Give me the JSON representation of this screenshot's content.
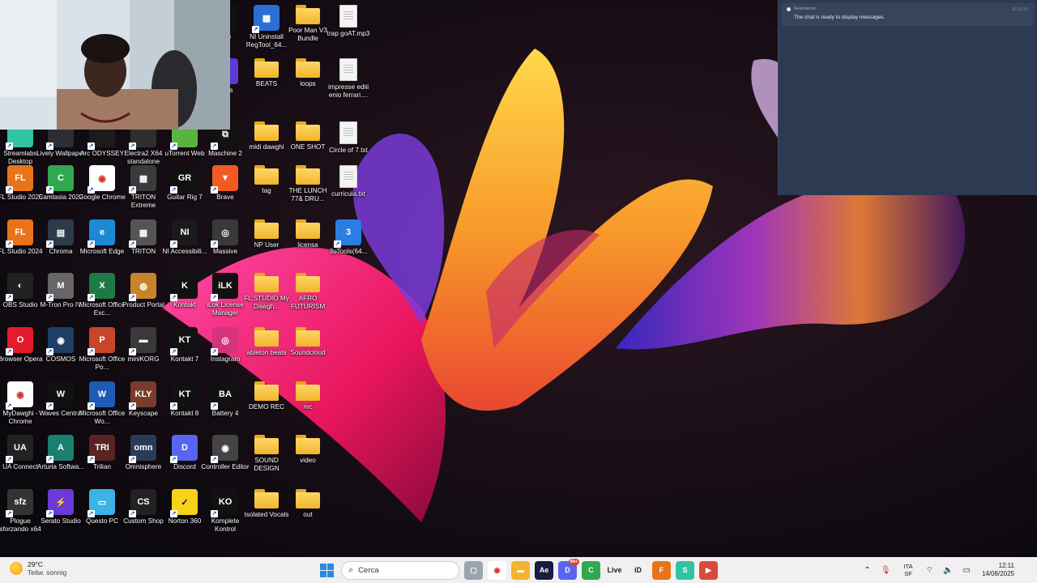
{
  "desktop": {
    "icons": [
      {
        "label": "Streamlabs Desktop",
        "kind": "app",
        "color": "#31c3a2",
        "text": ""
      },
      {
        "label": "Lively Wallpaper",
        "kind": "app",
        "color": "#2d2d35",
        "text": ""
      },
      {
        "label": "Arc ODYSSEY",
        "kind": "app",
        "color": "#1b1b1b",
        "text": ""
      },
      {
        "label": "Electra2 X64 standalone",
        "kind": "app",
        "color": "#2e2e2e",
        "text": ""
      },
      {
        "label": "uTorrent Web",
        "kind": "app",
        "color": "#58b441",
        "text": ""
      },
      {
        "label": "Maschine 2",
        "kind": "app",
        "color": "#111",
        "text": "⧉"
      },
      {
        "label": "midi dawghi",
        "kind": "folder"
      },
      {
        "label": "ONE SHOT",
        "kind": "folder"
      },
      {
        "label": "Circle of 7.txt",
        "kind": "file"
      },
      {
        "label": "FL Studio 2025",
        "kind": "app",
        "color": "#e9731b",
        "text": "FL"
      },
      {
        "label": "Camtasia 2022",
        "kind": "app",
        "color": "#2fa84e",
        "text": "C"
      },
      {
        "label": "Google Chrome",
        "kind": "app",
        "color": "#ffffff",
        "text": "◉"
      },
      {
        "label": "TRITON Extreme",
        "kind": "app",
        "color": "#3b3b3b",
        "text": "▦"
      },
      {
        "label": "Guitar Rig 7",
        "kind": "app",
        "color": "#111",
        "text": "GR"
      },
      {
        "label": "Brave",
        "kind": "app",
        "color": "#f15a22",
        "text": "▼"
      },
      {
        "label": "tag",
        "kind": "folder"
      },
      {
        "label": "THE LUNCH 77& DRU...",
        "kind": "folder"
      },
      {
        "label": "curricula.txt",
        "kind": "file"
      },
      {
        "label": "FL Studio 2024",
        "kind": "app",
        "color": "#e9731b",
        "text": "FL"
      },
      {
        "label": "Chroma",
        "kind": "app",
        "color": "#2d3a4a",
        "text": "▤"
      },
      {
        "label": "Microsoft Edge",
        "kind": "app",
        "color": "#1b8ad6",
        "text": "e"
      },
      {
        "label": "TRITON",
        "kind": "app",
        "color": "#555",
        "text": "▦"
      },
      {
        "label": "NI Accessibili...",
        "kind": "app",
        "color": "#1a1a1a",
        "text": "NI"
      },
      {
        "label": "Massive",
        "kind": "app",
        "color": "#3a3a3a",
        "text": "◎"
      },
      {
        "label": "NP User",
        "kind": "folder"
      },
      {
        "label": "licensa",
        "kind": "folder"
      },
      {
        "label": "3uTools(64...",
        "kind": "app",
        "color": "#2a7de1",
        "text": "3"
      },
      {
        "label": "OBS Studio",
        "kind": "app",
        "color": "#222",
        "text": "◐"
      },
      {
        "label": "M-Tron Pro IV",
        "kind": "app",
        "color": "#666",
        "text": "M"
      },
      {
        "label": "Microsoft Office Exc...",
        "kind": "app",
        "color": "#1d7a44",
        "text": "X"
      },
      {
        "label": "Product Portal",
        "kind": "app",
        "color": "#c7852b",
        "text": "◍"
      },
      {
        "label": "Kontakt",
        "kind": "app",
        "color": "#111",
        "text": "K"
      },
      {
        "label": "iLok License Manager",
        "kind": "app",
        "color": "#111",
        "text": "iLK"
      },
      {
        "label": "FL STUDIO My Dawgh...",
        "kind": "folder"
      },
      {
        "label": "AFRO FUTURISM",
        "kind": "folder"
      },
      {
        "label": "Browser Opera",
        "kind": "app",
        "color": "#e21c2c",
        "text": "O"
      },
      {
        "label": "COSMOS",
        "kind": "app",
        "color": "#1d3f66",
        "text": "◉"
      },
      {
        "label": "Microsoft Office Po...",
        "kind": "app",
        "color": "#c8452a",
        "text": "P"
      },
      {
        "label": "miniKORG",
        "kind": "app",
        "color": "#3a3a3a",
        "text": "▬"
      },
      {
        "label": "Kontakt 7",
        "kind": "app",
        "color": "#111",
        "text": "KT"
      },
      {
        "label": "Instagram",
        "kind": "app",
        "color": "#d6337a",
        "text": "◎"
      },
      {
        "label": "ableton beats",
        "kind": "folder"
      },
      {
        "label": "Soundcloud",
        "kind": "folder"
      },
      {
        "label": "MyDawghi - Chrome",
        "kind": "app",
        "color": "#ffffff",
        "text": "◉"
      },
      {
        "label": "Waves Central",
        "kind": "app",
        "color": "#111",
        "text": "W"
      },
      {
        "label": "Microsoft Office Wo...",
        "kind": "app",
        "color": "#1f5bb5",
        "text": "W"
      },
      {
        "label": "Keyscape",
        "kind": "app",
        "color": "#7a3b2a",
        "text": "KLY"
      },
      {
        "label": "Kontakt 8",
        "kind": "app",
        "color": "#111",
        "text": "KT"
      },
      {
        "label": "Battery 4",
        "kind": "app",
        "color": "#111",
        "text": "BA"
      },
      {
        "label": "DEMO REC",
        "kind": "folder"
      },
      {
        "label": "rec",
        "kind": "folder"
      },
      {
        "label": "UA Connect",
        "kind": "app",
        "color": "#222",
        "text": "UA"
      },
      {
        "label": "Arturia Softwa...",
        "kind": "app",
        "color": "#1a7f6e",
        "text": "A"
      },
      {
        "label": "Trilian",
        "kind": "app",
        "color": "#5a2323",
        "text": "TRI"
      },
      {
        "label": "Omnisphere",
        "kind": "app",
        "color": "#2c3b55",
        "text": "omn"
      },
      {
        "label": "Discord",
        "kind": "app",
        "color": "#5865f2",
        "text": "D"
      },
      {
        "label": "Controller Editor",
        "kind": "app",
        "color": "#444",
        "text": "◉"
      },
      {
        "label": "SOUND DESIGN",
        "kind": "folder"
      },
      {
        "label": "video",
        "kind": "folder"
      },
      {
        "label": "Plogue sforzando x64",
        "kind": "app",
        "color": "#333",
        "text": "sfz"
      },
      {
        "label": "Serato Studio",
        "kind": "app",
        "color": "#6b3ad6",
        "text": "⚡"
      },
      {
        "label": "Questo PC",
        "kind": "app",
        "color": "#3db3e3",
        "text": "▭"
      },
      {
        "label": "Custom Shop",
        "kind": "app",
        "color": "#222",
        "text": "CS"
      },
      {
        "label": "Norton 360",
        "kind": "app",
        "color": "#f6d21a",
        "text": "✓"
      },
      {
        "label": "Komplete Kontrol",
        "kind": "app",
        "color": "#111",
        "text": "KO"
      },
      {
        "label": "Isolated Vocals",
        "kind": "folder"
      },
      {
        "label": "out",
        "kind": "folder"
      }
    ],
    "top_icons": [
      {
        "label": "or 6",
        "kind": "app",
        "color": "#111",
        "text": ""
      },
      {
        "label": "NI Uninstall RegTool_64...",
        "kind": "app",
        "color": "#2a6fd6",
        "text": "▦"
      },
      {
        "label": "Poor Man V3 Bundle",
        "kind": "folder"
      },
      {
        "label": "trap goAT.mp3",
        "kind": "file"
      },
      {
        "label": "Tools",
        "kind": "app",
        "color": "#5b3ad6",
        "text": ""
      },
      {
        "label": "BEATS",
        "kind": "folder"
      },
      {
        "label": "loops",
        "kind": "folder"
      },
      {
        "label": "impresse ediii enio ferrari....",
        "kind": "file"
      }
    ]
  },
  "chat": {
    "sender": "Restream.io",
    "time": "11:10:24",
    "message": "The chat is ready to display messages."
  },
  "taskbar": {
    "temperature": "29°C",
    "weather": "Teilw. sonnig",
    "search_placeholder": "Cerca",
    "badge_count": "99+",
    "language": "ITA",
    "keyboard": "SF",
    "time": "12:11",
    "date": "14/08/2025",
    "apps": [
      {
        "name": "file-explorer",
        "color": "#9aa4b0",
        "text": "▢"
      },
      {
        "name": "chrome",
        "color": "#ffffff",
        "text": "◉"
      },
      {
        "name": "folder",
        "color": "#f0b52b",
        "text": "▬"
      },
      {
        "name": "after-effects",
        "color": "#1b1a3f",
        "text": "Ae"
      },
      {
        "name": "discord",
        "color": "#5865f2",
        "text": "D"
      },
      {
        "name": "camtasia",
        "color": "#2fa84e",
        "text": "C"
      },
      {
        "name": "live",
        "color": "#f2eff0",
        "text": "Live"
      },
      {
        "name": "id",
        "color": "#f2eff0",
        "text": "iD"
      },
      {
        "name": "fl-studio",
        "color": "#e9731b",
        "text": "F"
      },
      {
        "name": "streamlabs",
        "color": "#31c3a2",
        "text": "S"
      },
      {
        "name": "recorder",
        "color": "#d84a3a",
        "text": "▶"
      }
    ]
  }
}
